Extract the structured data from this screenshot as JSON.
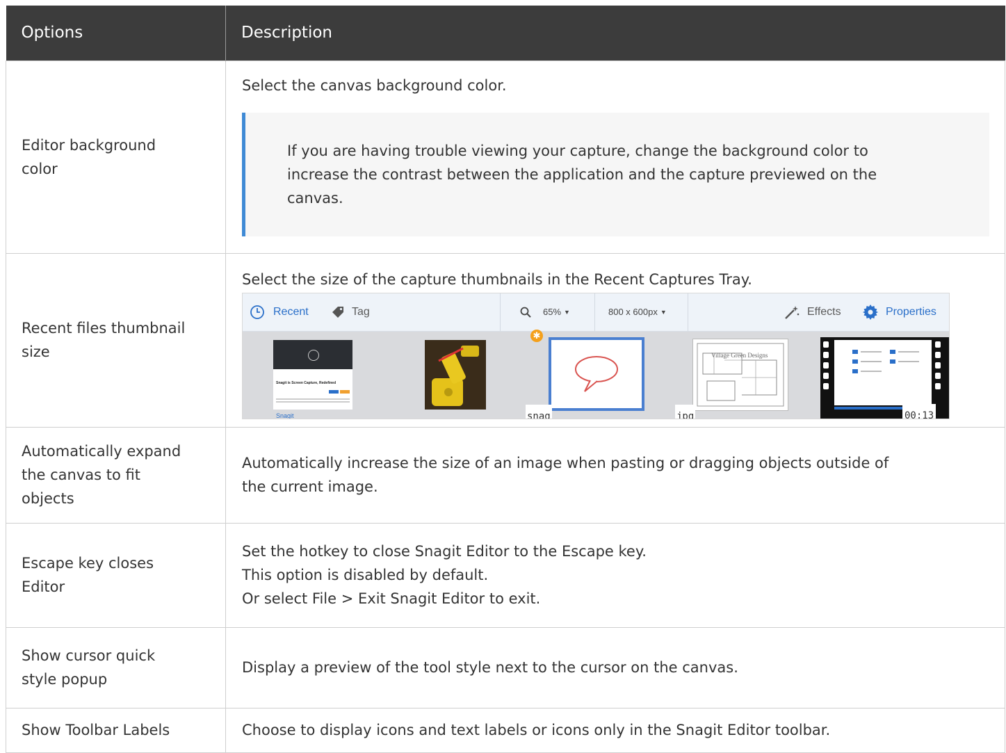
{
  "table": {
    "headers": [
      "Options",
      "Description"
    ],
    "rows": [
      {
        "option": [
          "Editor background",
          "color"
        ],
        "description": [
          "Select the canvas background color."
        ],
        "note": [
          "If you are having trouble viewing your capture, change the background color to",
          "increase the contrast between the application and the capture previewed on the",
          "canvas."
        ]
      },
      {
        "option": [
          "Recent files thumbnail",
          "size"
        ],
        "description": [
          "Select the size of the capture thumbnails in the Recent Captures Tray."
        ]
      },
      {
        "option": [
          "Automatically expand",
          "the canvas to fit",
          "objects"
        ],
        "description": [
          "Automatically increase the size of an image when pasting or dragging objects outside of",
          "the current image."
        ]
      },
      {
        "option": [
          "Escape key closes",
          "Editor"
        ],
        "description": [
          "Set the hotkey to close Snagit Editor to the Escape key.",
          "This option is disabled by default.",
          "Or select File > Exit Snagit Editor to exit."
        ]
      },
      {
        "option": [
          "Show cursor quick",
          "style popup"
        ],
        "description": [
          "Display a preview of the tool style next to the cursor on the canvas."
        ]
      },
      {
        "option": [
          "Show Toolbar Labels"
        ],
        "description": [
          "Choose to display icons and text labels or icons only in the Snagit Editor toolbar."
        ]
      }
    ]
  },
  "tray": {
    "recent_label": "Recent",
    "tag_label": "Tag",
    "zoom_label": "65%",
    "size_label": "800 x 600px",
    "effects_label": "Effects",
    "properties_label": "Properties",
    "thumb_labels": {
      "snag": "snag",
      "jpg": "jpg",
      "duration": "00:13"
    },
    "thumb1_logo": "Snagit",
    "thumb1_heading": "Snagit is Screen Capture, Redefined",
    "thumb4_watermark": "Village Green Designs"
  },
  "colors": {
    "header_bg": "#3c3c3c",
    "note_border": "#3f8ad5",
    "accent_blue": "#2a6fc9",
    "badge": "#f4a01b"
  }
}
